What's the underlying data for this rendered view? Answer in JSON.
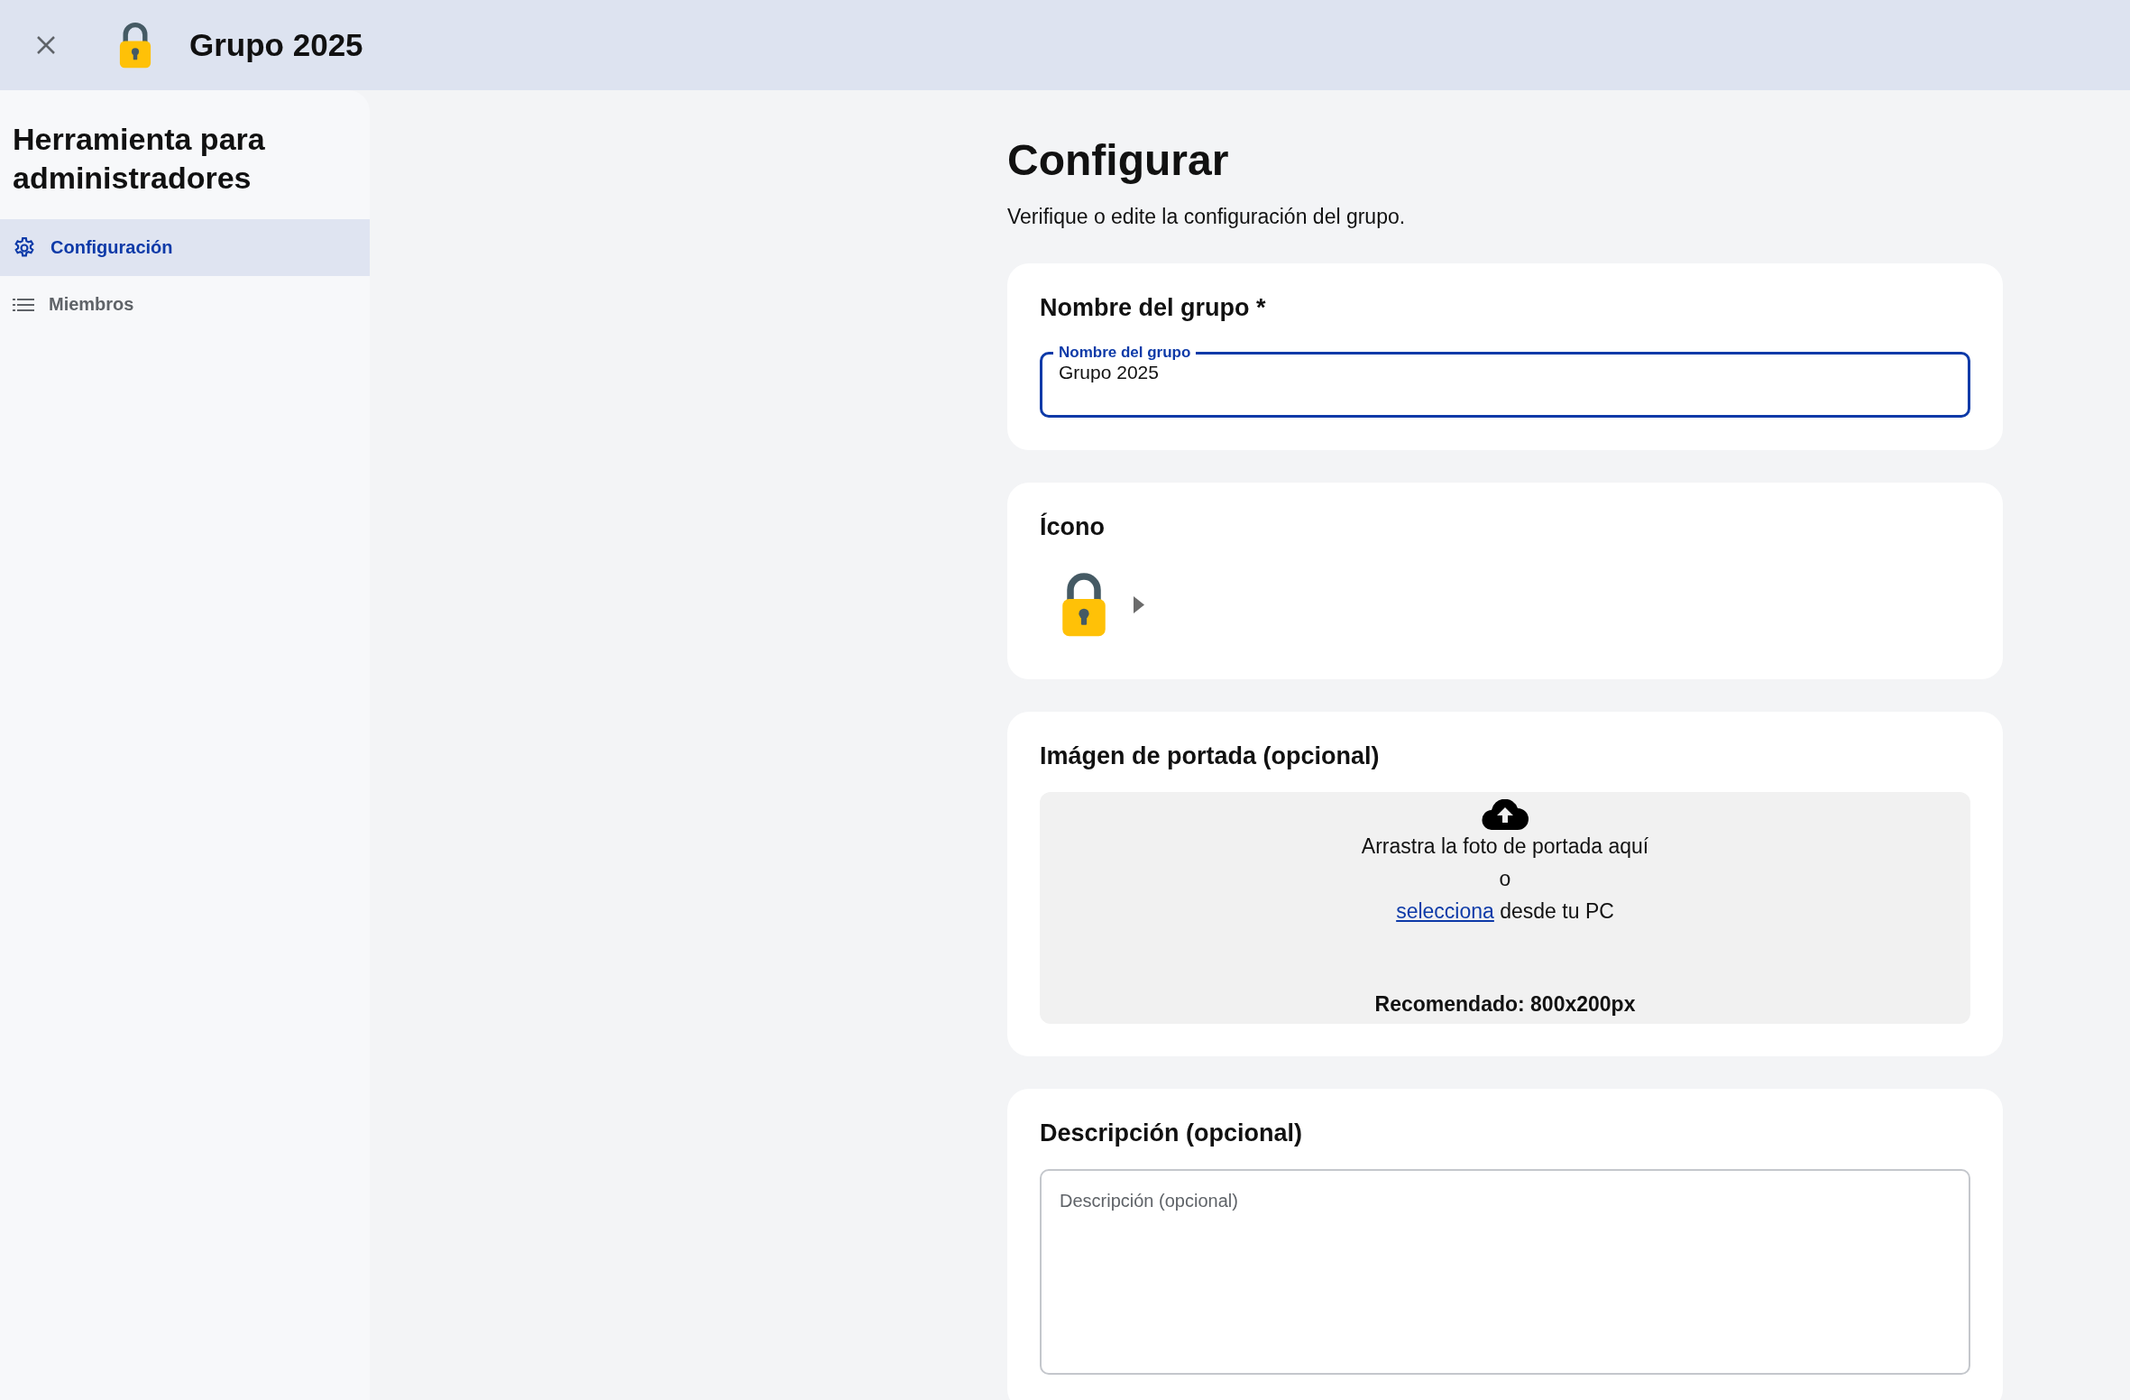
{
  "header": {
    "title": "Grupo 2025"
  },
  "sidebar": {
    "title": "Herramienta para administradores",
    "items": [
      {
        "label": "Configuración",
        "selected": true
      },
      {
        "label": "Miembros",
        "selected": false
      }
    ]
  },
  "page": {
    "title": "Configurar",
    "subtitle": "Verifique o edite la configuración del grupo."
  },
  "name_section": {
    "title": "Nombre del grupo *",
    "field_label": "Nombre del grupo",
    "value": "Grupo 2025"
  },
  "icon_section": {
    "title": "Ícono"
  },
  "cover_section": {
    "title": "Imágen de portada (opcional)",
    "drop_text": "Arrastra la foto de portada aquí",
    "or_text": "o",
    "link": "selecciona",
    "link_suffix": " desde tu PC",
    "recommended": "Recomendado: 800x200px"
  },
  "description_section": {
    "title": "Descripción (opcional)",
    "placeholder": "Descripción (opcional)"
  }
}
